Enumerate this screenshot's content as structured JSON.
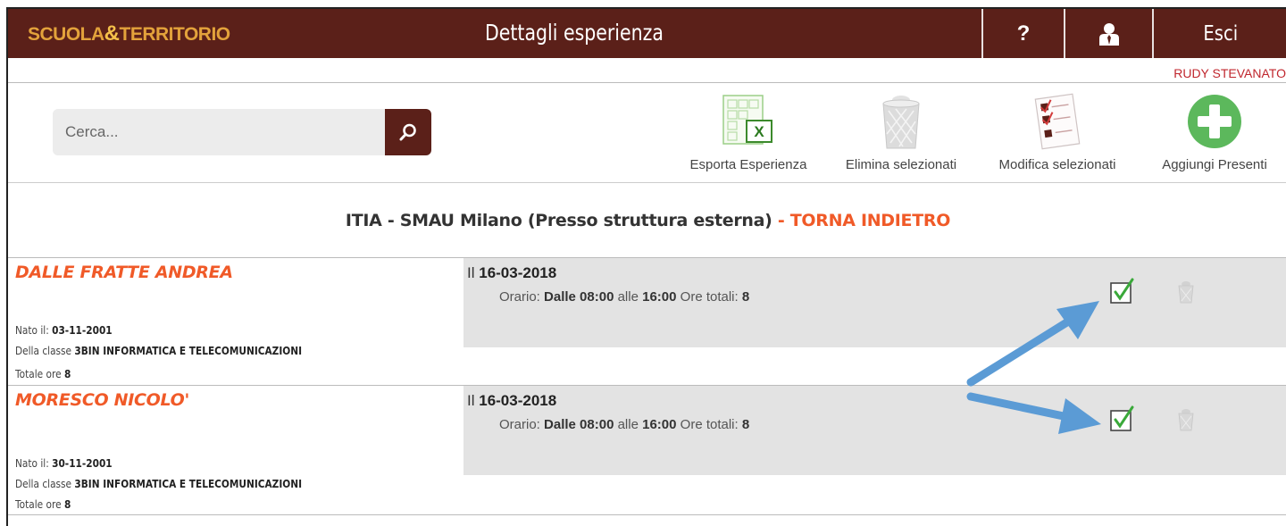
{
  "header": {
    "logo_left": "SCUOLA",
    "logo_amp": "&",
    "logo_right": "TERRITORIO",
    "title": "Dettagli esperienza",
    "help_label": "?",
    "logout_label": "Esci"
  },
  "user": {
    "name": "RUDY STEVANATO"
  },
  "search": {
    "placeholder": "Cerca..."
  },
  "toolbar": {
    "export_label": "Esporta Esperienza",
    "delete_label": "Elimina selezionati",
    "edit_label": "Modifica selezionati",
    "add_label": "Aggiungi Presenti"
  },
  "experience": {
    "title": "ITIA - SMAU Milano (Presso struttura esterna)",
    "back_label": "- TORNA INDIETRO"
  },
  "labels": {
    "born": "Nato il: ",
    "class": "Della classe ",
    "total": "Totale ore ",
    "date_prefix": "Il ",
    "schedule": "Orario: ",
    "from": "Dalle ",
    "to": " alle ",
    "hours": " Ore totali: "
  },
  "students": [
    {
      "name": "DALLE FRATTE ANDREA",
      "birth": "03-11-2001",
      "class": "3BIN INFORMATICA E TELECOMUNICAZIONI",
      "total": "8",
      "date": "16-03-2018",
      "from": "08:00",
      "to": "16:00",
      "hours": "8",
      "checked": true
    },
    {
      "name": "MORESCO NICOLO'",
      "birth": "30-11-2001",
      "class": "3BIN INFORMATICA E TELECOMUNICAZIONI",
      "total": "8",
      "date": "16-03-2018",
      "from": "08:00",
      "to": "16:00",
      "hours": "8",
      "checked": true
    }
  ],
  "colors": {
    "header_bg": "#5b2019",
    "accent": "#f05a28",
    "username": "#c0262d",
    "annotation_arrow": "#5b9bd5",
    "check_green": "#3aa93a"
  }
}
